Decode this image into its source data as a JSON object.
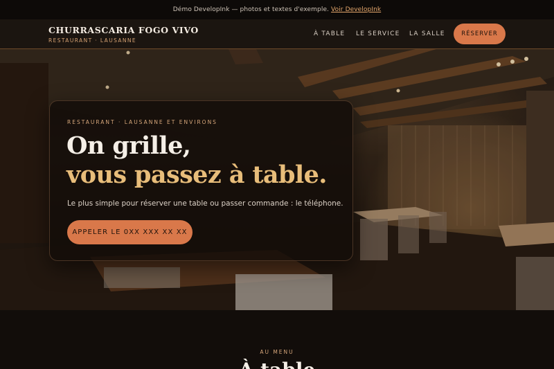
{
  "banner": {
    "text": "Démo DevelopInk — photos et textes d'exemple.",
    "link_label": "Voir DevelopInk"
  },
  "header": {
    "brand_name": "CHURRASCARIA FOGO VIVO",
    "brand_sub": "RESTAURANT · LAUSANNE",
    "nav": [
      {
        "label": "À TABLE"
      },
      {
        "label": "LE SERVICE"
      },
      {
        "label": "LA SALLE"
      }
    ],
    "cta_label": "RÉSERVER"
  },
  "hero": {
    "eyebrow": "RESTAURANT · LAUSANNE ET ENVIRONS",
    "title_line1": "On grille,",
    "title_line2": "vous passez à table.",
    "description": "Le plus simple pour réserver une table ou passer commande : le téléphone.",
    "cta_label": "APPELER LE 0XX XXX XX XX"
  },
  "menu_section": {
    "eyebrow": "AU MENU",
    "title": "À table"
  },
  "colors": {
    "accent": "#d9784a",
    "gold": "#e8bd7a",
    "background": "#120d0a"
  }
}
